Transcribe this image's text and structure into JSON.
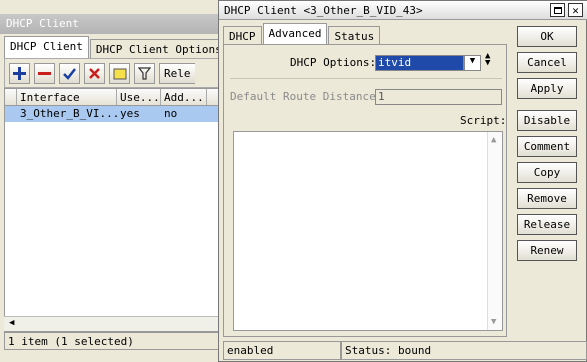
{
  "bg_window": {
    "title": "DHCP Client",
    "tabs": [
      "DHCP Client",
      "DHCP Client Options"
    ],
    "toolbar_release_label": "Rele",
    "table": {
      "columns": [
        "Interface",
        "Use...",
        "Add..."
      ],
      "rows": [
        [
          "3_Other_B_VI...",
          "yes",
          "no"
        ]
      ]
    },
    "status": "1 item (1 selected)"
  },
  "dialog": {
    "title": "DHCP Client <3_Other_B_VID_43>",
    "tabs": [
      "DHCP",
      "Advanced",
      "Status"
    ],
    "active_tab": "Advanced",
    "fields": {
      "dhcp_options_label": "DHCP Options:",
      "dhcp_options_value": "itvid",
      "default_route_distance_label": "Default Route Distance:",
      "default_route_distance_value": "1",
      "script_label": "Script:"
    },
    "buttons": [
      "OK",
      "Cancel",
      "Apply",
      "Disable",
      "Comment",
      "Copy",
      "Remove",
      "Release",
      "Renew"
    ],
    "status": {
      "left": "enabled",
      "right": "Status: bound"
    }
  },
  "colors": {
    "selection": "#1f4aa9",
    "row_highlight": "#a9c9f0",
    "add_icon": "#1a3fa0",
    "remove_icon": "#c81e1e"
  }
}
